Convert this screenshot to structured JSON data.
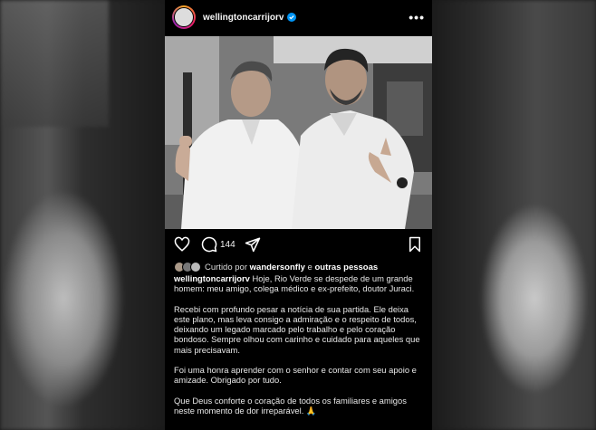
{
  "post": {
    "username": "wellingtoncarrijorv",
    "verified": true,
    "comment_count": "144",
    "liked_by_prefix": "Curtido por",
    "liked_by_user": "wandersonfly",
    "liked_by_and": "e",
    "liked_by_others": "outras pessoas",
    "caption": [
      "Hoje, Rio Verde se despede de um grande homem: meu amigo, colega médico e ex-prefeito, doutor Juraci.",
      "Recebi com profundo pesar a notícia de sua partida. Ele deixa este plano, mas leva consigo a admiração e o respeito de todos, deixando um legado marcado pelo trabalho e pelo coração bondoso. Sempre olhou com carinho e cuidado para aqueles que mais precisavam.",
      "Foi uma honra aprender com o senhor e contar com seu apoio e amizade. Obrigado por tudo.",
      "Que Deus conforte o coração de todos os familiares e amigos neste momento de dor irreparável. 🙏"
    ]
  },
  "icons": {
    "like": "heart-icon",
    "comment": "comment-icon",
    "share": "share-icon",
    "save": "bookmark-icon",
    "more": "more-options-icon",
    "verified": "verified-badge-icon"
  },
  "colors": {
    "background": "#000000",
    "verified": "#0095f6",
    "text": "#f5f5f5"
  }
}
